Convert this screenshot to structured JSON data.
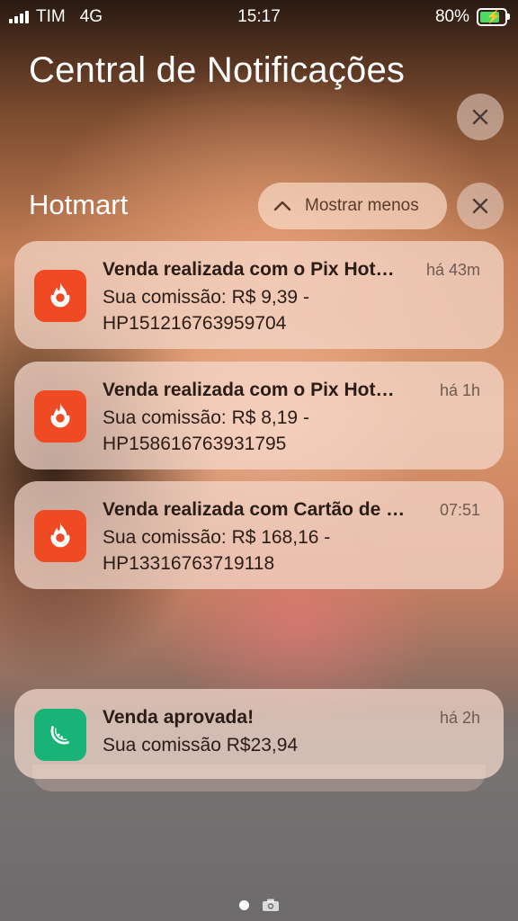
{
  "status": {
    "carrier": "TIM",
    "network": "4G",
    "time": "15:17",
    "battery": "80%",
    "battery_level": 0.8
  },
  "header": {
    "title": "Central de Notificações"
  },
  "group": {
    "name": "Hotmart",
    "collapse_label": "Mostrar menos"
  },
  "notifications": [
    {
      "app": "Hotmart",
      "title": "Venda realizada com o Pix Hotmart",
      "time": "há 43m",
      "body_line1": "Sua comissão: R$ 9,39 -",
      "body_line2": "HP151216763959704"
    },
    {
      "app": "Hotmart",
      "title": "Venda realizada com o Pix Hotmart",
      "time": "há 1h",
      "body_line1": "Sua comissão: R$ 8,19 -",
      "body_line2": "HP158616763931795"
    },
    {
      "app": "Hotmart",
      "title": "Venda realizada com Cartão de crédito",
      "time": "07:51",
      "body_line1": "Sua comissão: R$ 168,16 -",
      "body_line2": "HP13316763719118"
    }
  ],
  "other": {
    "title": "Venda aprovada!",
    "time": "há 2h",
    "body": "Sua comissão R$23,94"
  },
  "colors": {
    "hotmart": "#ef4a23",
    "green_app": "#19b277"
  }
}
